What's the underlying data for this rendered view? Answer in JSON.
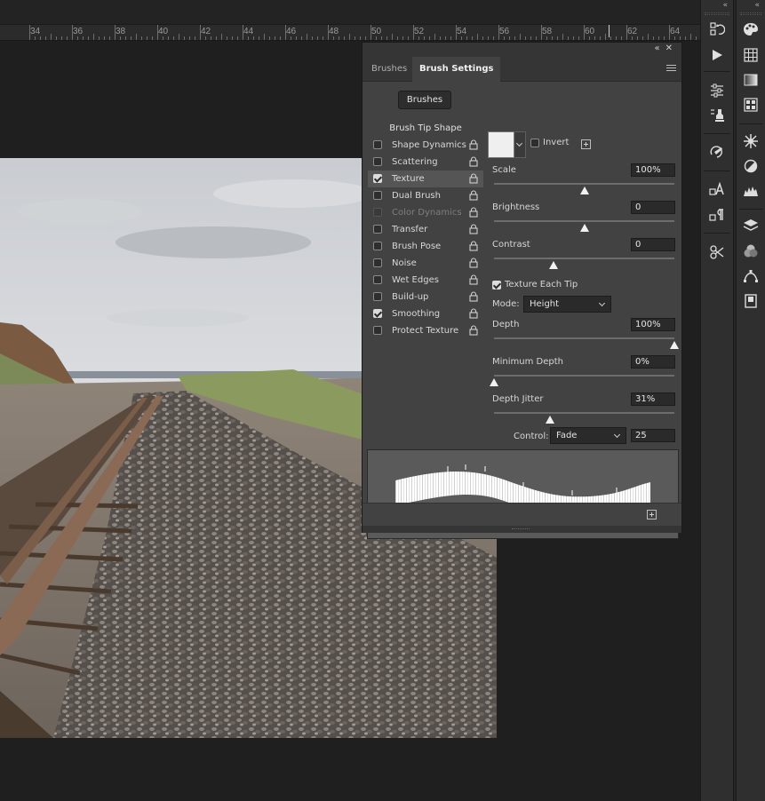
{
  "ruler": {
    "labels": [
      "34",
      "36",
      "38",
      "40",
      "42",
      "44",
      "46",
      "48",
      "50",
      "52",
      "54",
      "56",
      "58",
      "60",
      "62",
      "64"
    ]
  },
  "panel": {
    "tabs": [
      {
        "label": "Brushes",
        "active": false
      },
      {
        "label": "Brush Settings",
        "active": true
      }
    ],
    "brushes_button": "Brushes",
    "list_header": "Brush Tip Shape",
    "items": [
      {
        "label": "Shape Dynamics",
        "checked": false,
        "selected": false,
        "disabled": false
      },
      {
        "label": "Scattering",
        "checked": false,
        "selected": false,
        "disabled": false
      },
      {
        "label": "Texture",
        "checked": true,
        "selected": true,
        "disabled": false
      },
      {
        "label": "Dual Brush",
        "checked": false,
        "selected": false,
        "disabled": false
      },
      {
        "label": "Color Dynamics",
        "checked": false,
        "selected": false,
        "disabled": true
      },
      {
        "label": "Transfer",
        "checked": false,
        "selected": false,
        "disabled": false
      },
      {
        "label": "Brush Pose",
        "checked": false,
        "selected": false,
        "disabled": false
      },
      {
        "label": "Noise",
        "checked": false,
        "selected": false,
        "disabled": false
      },
      {
        "label": "Wet Edges",
        "checked": false,
        "selected": false,
        "disabled": false
      },
      {
        "label": "Build-up",
        "checked": false,
        "selected": false,
        "disabled": false
      },
      {
        "label": "Smoothing",
        "checked": true,
        "selected": false,
        "disabled": false
      },
      {
        "label": "Protect Texture",
        "checked": false,
        "selected": false,
        "disabled": false
      }
    ],
    "texture": {
      "invert_label": "Invert",
      "invert_checked": false,
      "scale": {
        "label": "Scale",
        "value": "100%",
        "slider": 0.5
      },
      "brightness": {
        "label": "Brightness",
        "value": "0",
        "slider": 0.5
      },
      "contrast": {
        "label": "Contrast",
        "value": "0",
        "slider": 0.33
      },
      "each_tip": {
        "label": "Texture Each Tip",
        "checked": true
      },
      "mode": {
        "label": "Mode:",
        "value": "Height"
      },
      "depth": {
        "label": "Depth",
        "value": "100%",
        "slider": 1.0
      },
      "min_depth": {
        "label": "Minimum Depth",
        "value": "0%",
        "slider": 0.0
      },
      "depth_jitter": {
        "label": "Depth Jitter",
        "value": "31%",
        "slider": 0.31
      },
      "control": {
        "label": "Control:",
        "value": "Fade",
        "amount": "25"
      }
    }
  },
  "colors": {
    "panel_bg": "#424242",
    "input_bg": "#2a2a2a",
    "accent_text": "#f0f0f0"
  },
  "icons": {
    "toolbar_1": [
      "history-icon",
      "play-actions-icon",
      "adjustments-icon",
      "clone-source-icon",
      "brush-presets-icon",
      "character-icon",
      "paragraph-style-icon",
      "tool-presets-icon"
    ],
    "toolbar_2": [
      "color-palette-icon",
      "swatches-grid-icon",
      "gradient-icon",
      "patterns-icon",
      "navigator-wheel-icon",
      "adjust-circle-icon",
      "histogram-icon",
      "layers-icon",
      "channels-icon",
      "paths-icon",
      "libraries-icon"
    ]
  }
}
